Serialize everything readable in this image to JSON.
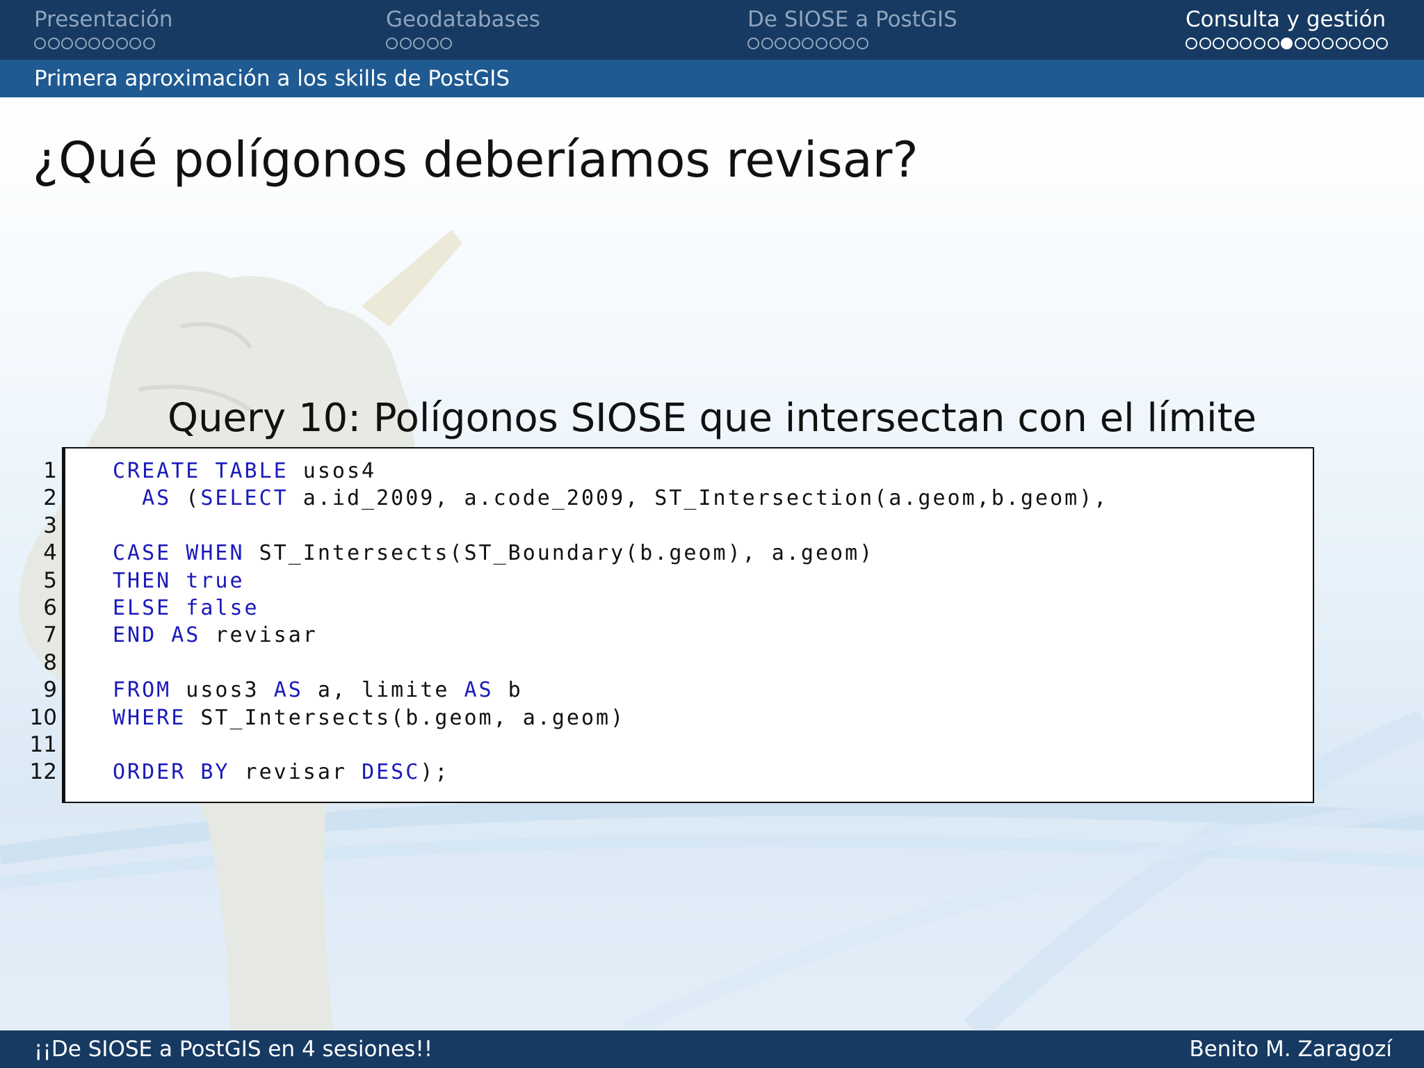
{
  "nav": {
    "sections": [
      {
        "title": "Presentación",
        "dot_count": 9,
        "active": false,
        "filled_index": -1
      },
      {
        "title": "Geodatabases",
        "dot_count": 5,
        "active": false,
        "filled_index": -1
      },
      {
        "title": "De SIOSE a PostGIS",
        "dot_count": 9,
        "active": false,
        "filled_index": -1
      },
      {
        "title": "Consulta y gestión",
        "dot_count": 15,
        "active": true,
        "filled_index": 7
      }
    ],
    "subsection": "Primera aproximación a los skills de PostGIS"
  },
  "frame": {
    "title": "¿Qué polígonos deberíamos revisar?",
    "block_title": "Query 10: Polígonos SIOSE que intersectan con el límite"
  },
  "code": {
    "keyword_color": "#1a1aba",
    "lines": [
      {
        "num": "1",
        "tokens": [
          {
            "t": "CREATE TABLE",
            "kw": true
          },
          {
            "t": " usos4",
            "kw": false
          }
        ]
      },
      {
        "num": "2",
        "tokens": [
          {
            "t": "  AS",
            "kw": true
          },
          {
            "t": " (",
            "kw": false
          },
          {
            "t": "SELECT",
            "kw": true
          },
          {
            "t": " a.id_2009, a.code_2009, ST_Intersection(a.geom,b.geom),",
            "kw": false
          }
        ]
      },
      {
        "num": "3",
        "tokens": []
      },
      {
        "num": "4",
        "tokens": [
          {
            "t": "CASE WHEN",
            "kw": true
          },
          {
            "t": " ST_Intersects(ST_Boundary(b.geom), a.geom)",
            "kw": false
          }
        ]
      },
      {
        "num": "5",
        "tokens": [
          {
            "t": "THEN true",
            "kw": true
          }
        ]
      },
      {
        "num": "6",
        "tokens": [
          {
            "t": "ELSE false",
            "kw": true
          }
        ]
      },
      {
        "num": "7",
        "tokens": [
          {
            "t": "END AS",
            "kw": true
          },
          {
            "t": " revisar",
            "kw": false
          }
        ]
      },
      {
        "num": "8",
        "tokens": []
      },
      {
        "num": "9",
        "tokens": [
          {
            "t": "FROM",
            "kw": true
          },
          {
            "t": " usos3 ",
            "kw": false
          },
          {
            "t": "AS",
            "kw": true
          },
          {
            "t": " a, limite ",
            "kw": false
          },
          {
            "t": "AS",
            "kw": true
          },
          {
            "t": " b",
            "kw": false
          }
        ]
      },
      {
        "num": "10",
        "tokens": [
          {
            "t": "WHERE",
            "kw": true
          },
          {
            "t": " ST_Intersects(b.geom, a.geom)",
            "kw": false
          }
        ]
      },
      {
        "num": "11",
        "tokens": []
      },
      {
        "num": "12",
        "tokens": [
          {
            "t": "ORDER BY",
            "kw": true
          },
          {
            "t": " revisar ",
            "kw": false
          },
          {
            "t": "DESC",
            "kw": true
          },
          {
            "t": ");",
            "kw": false
          }
        ]
      }
    ]
  },
  "footer": {
    "left": "¡¡De SIOSE a PostGIS en 4 sesiones!!",
    "right": "Benito M. Zaragozí"
  },
  "colors": {
    "nav_bg": "#163a62",
    "subnav_bg": "#1f5a92",
    "footer_bg": "#163a62"
  }
}
